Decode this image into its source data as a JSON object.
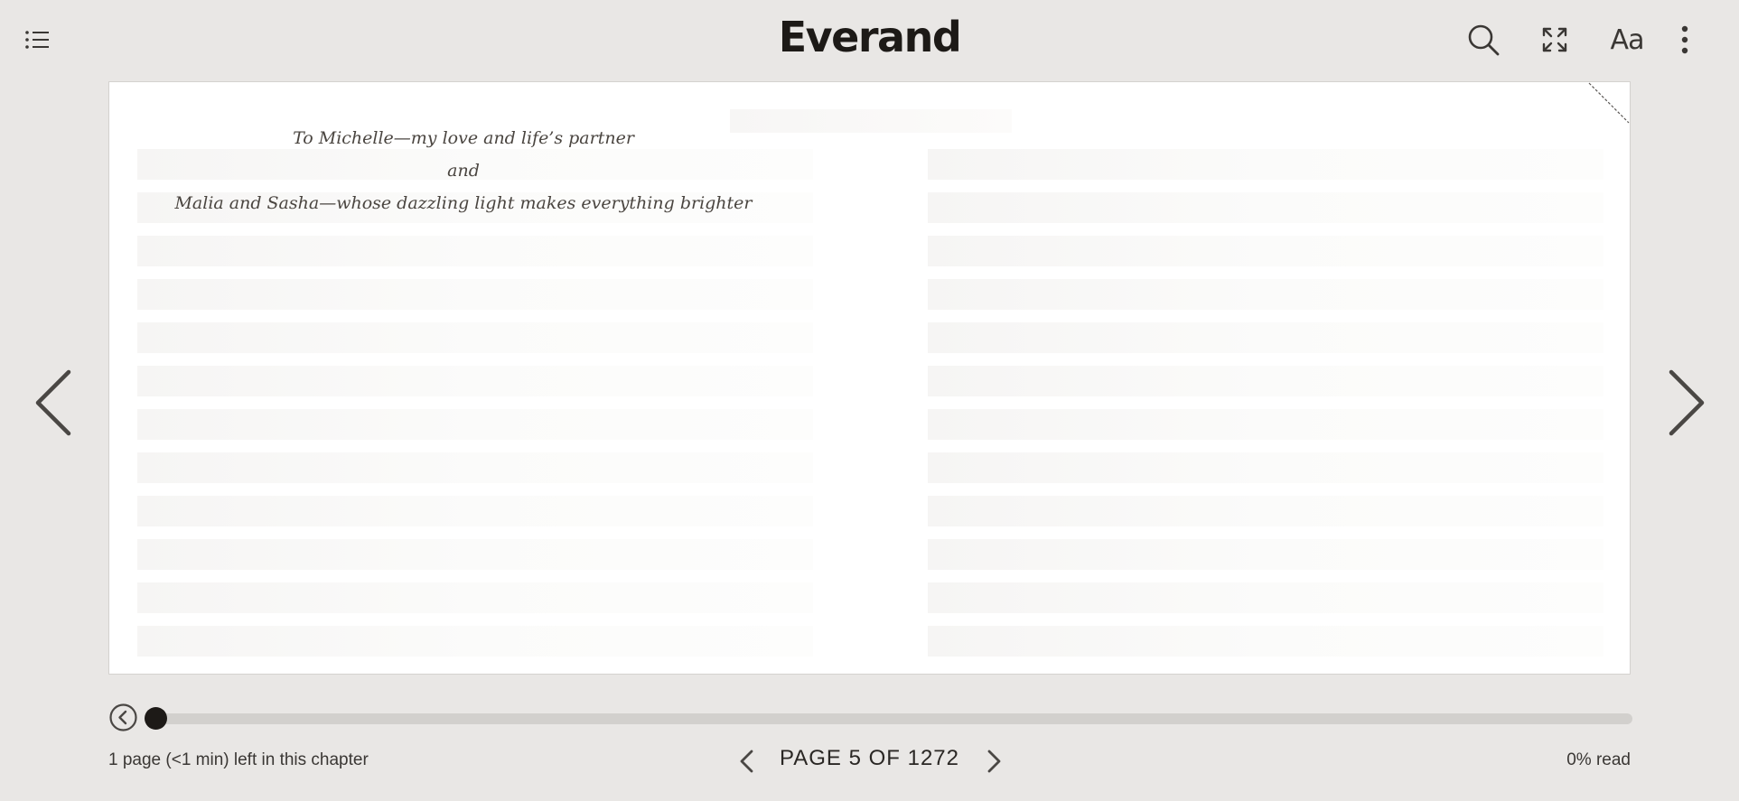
{
  "app": {
    "logo_text": "Everand"
  },
  "header": {
    "icons": [
      "table-of-contents-icon",
      "search-icon",
      "fullscreen-icon",
      "font-settings-icon",
      "more-options-icon"
    ],
    "font_button_label": "Aa"
  },
  "book": {
    "dedication": {
      "line1": "To Michelle—my love and life’s partner",
      "line2": "and",
      "line3": "Malia and Sasha—whose dazzling light makes everything brighter"
    }
  },
  "footer": {
    "chapter_remaining": "1 page (<1 min) left in this chapter",
    "page_indicator": "PAGE 5 OF 1272",
    "read_percent_label": "0% read",
    "progress_fraction": 0.0
  },
  "colors": {
    "background": "#e9e7e5",
    "page": "#ffffff",
    "accent": "#1d1a17",
    "track": "#d2d0cd"
  }
}
